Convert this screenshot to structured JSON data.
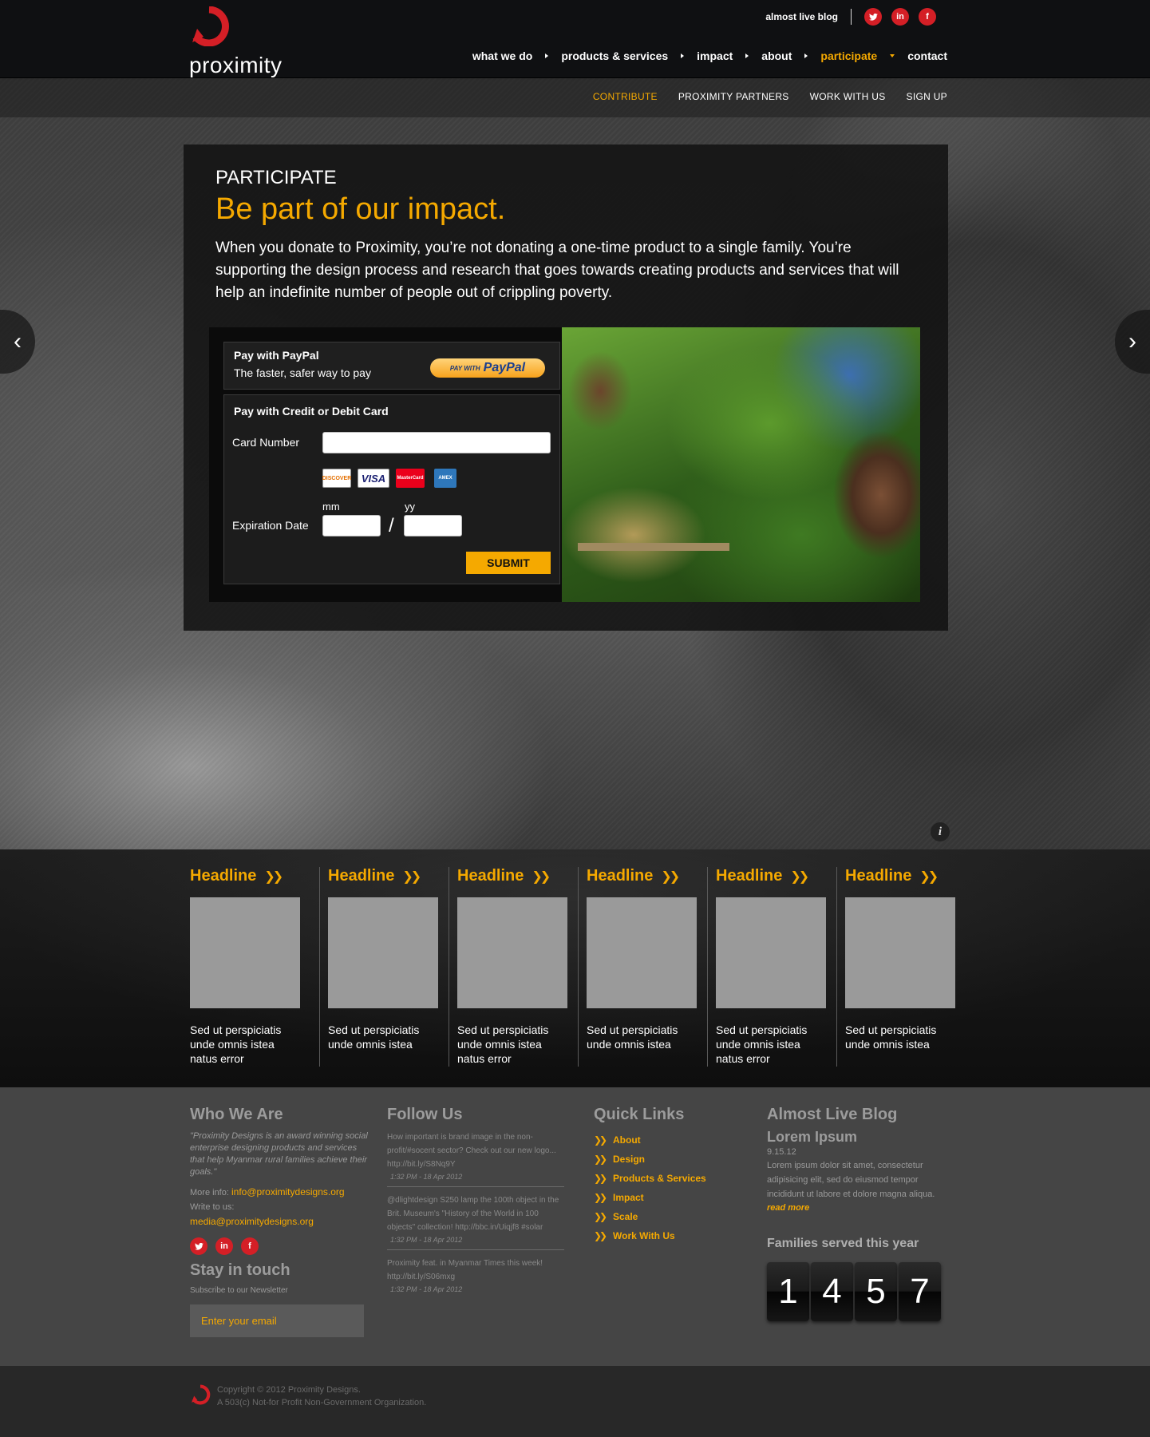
{
  "header": {
    "logo_text": "proximity",
    "util_link": "almost live blog",
    "social": [
      {
        "name": "twitter-icon",
        "glyph": "✦"
      },
      {
        "name": "linkedin-icon",
        "glyph": "in"
      },
      {
        "name": "facebook-icon",
        "glyph": "f"
      }
    ],
    "nav": [
      "what we do",
      "products & services",
      "impact",
      "about",
      "participate",
      "contact"
    ],
    "nav_active": "participate"
  },
  "subnav": [
    "CONTRIBUTE",
    "PROXIMITY PARTNERS",
    "WORK WITH US",
    "SIGN UP"
  ],
  "subnav_active": "CONTRIBUTE",
  "hero": {
    "kicker": "PARTICIPATE",
    "headline": "Be part of our impact.",
    "intro": "When you donate to Proximity, you’re not donating a one-time product to a single family. You’re supporting the design process and research that goes towards creating products and services that will help an indefinite number of people out of crippling poverty.",
    "prev_arrow": "‹",
    "next_arrow": "›"
  },
  "payment": {
    "paypal_title": "Pay with PayPal",
    "paypal_sub": "The faster, safer way to pay",
    "paypal_btn_prefix": "PAY WITH",
    "paypal_btn_brand": "PayPal",
    "card_title": "Pay with Credit or Debit Card",
    "card_number_label": "Card Number",
    "card_logos": [
      "DISCOVER",
      "VISA",
      "MasterCard",
      "AMEX"
    ],
    "mm_label": "mm",
    "yy_label": "yy",
    "exp_label": "Expiration Date",
    "slash": "/",
    "submit_label": "SUBMIT"
  },
  "info_icon": "i",
  "headlines": [
    {
      "title": "Headline",
      "text": "Sed ut perspiciatis unde omnis istea natus error"
    },
    {
      "title": "Headline",
      "text": "Sed ut perspiciatis unde omnis istea"
    },
    {
      "title": "Headline",
      "text": "Sed ut perspiciatis unde omnis istea natus error"
    },
    {
      "title": "Headline",
      "text": "Sed ut perspiciatis unde omnis istea"
    },
    {
      "title": "Headline",
      "text": "Sed ut perspiciatis unde omnis istea natus error"
    },
    {
      "title": "Headline",
      "text": "Sed ut perspiciatis unde omnis istea"
    }
  ],
  "footer": {
    "who": {
      "title": "Who We Are",
      "quote": "\"Proximity Designs is an award winning social enterprise designing products and services that help Myanmar rural families achieve their goals.\"",
      "more_label": "More info:",
      "more_email": "info@proximitydesigns.org",
      "write_label": "Write to us:",
      "write_email": "media@proximitydesigns.org",
      "stay_title": "Stay in touch",
      "subscribe": "Subscribe to our Newsletter",
      "email_placeholder": "Enter your email"
    },
    "follow": {
      "title": "Follow Us",
      "tweets": [
        {
          "text": "How important is brand image in the non-profit/#socent sector? Check out our new logo... http://bit.ly/S8Nq9Y",
          "time": "1:32 PM - 18 Apr 2012"
        },
        {
          "text": "@dlightdesign S250 lamp the 100th object in the Brit. Museum's \"History of the World in 100 objects\" collection! http://bbc.in/Uiqjf8 #solar",
          "time": "1:32 PM - 18 Apr 2012"
        },
        {
          "text": "Proximity feat. in Myanmar Times this week! http://bit.ly/S06mxg",
          "time": "1:32 PM - 18 Apr 2012"
        }
      ]
    },
    "quick": {
      "title": "Quick Links",
      "links": [
        "About",
        "Design",
        "Products & Services",
        "Impact",
        "Scale",
        "Work With Us"
      ]
    },
    "blog": {
      "title": "Almost Live Blog",
      "post_title": "Lorem Ipsum",
      "date": "9.15.12",
      "body": "Lorem ipsum dolor sit amet, consectetur adipisicing elit, sed do eiusmod tempor incididunt ut labore et dolore magna aliqua.",
      "read_more": "read more",
      "families_title": "Families served this year",
      "counter": [
        "1",
        "4",
        "5",
        "7"
      ]
    }
  },
  "bottom": {
    "copyright": "Copyright © 2012 Proximity Designs.",
    "org": "A 503(c) Not-for Profit Non-Government Organization."
  },
  "colors": {
    "accent": "#f5a900",
    "brand_red": "#d41f26"
  }
}
